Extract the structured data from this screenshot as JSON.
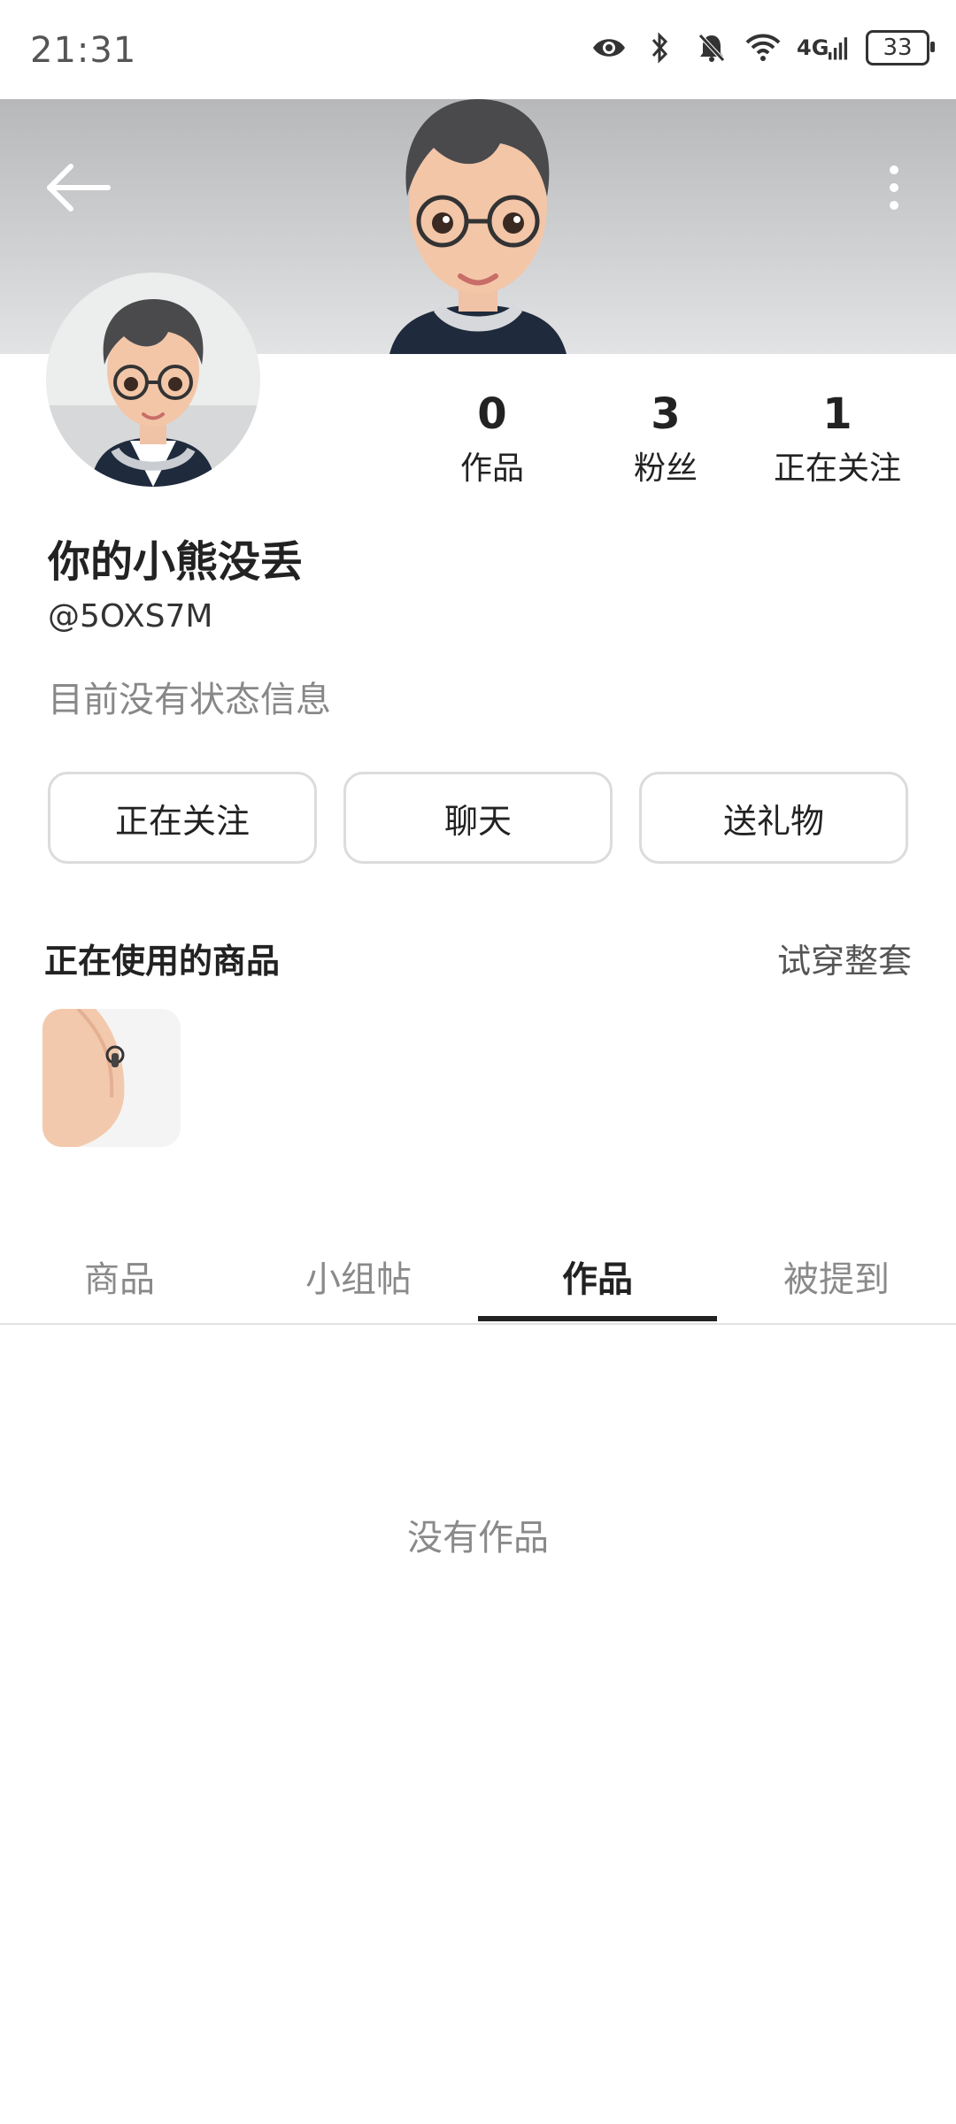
{
  "status_bar": {
    "time": "21:31",
    "network": "4G",
    "battery": "33"
  },
  "profile": {
    "name": "你的小熊没丢",
    "handle": "@5OXS7M",
    "status": "目前没有状态信息"
  },
  "stats": [
    {
      "value": "0",
      "label": "作品"
    },
    {
      "value": "3",
      "label": "粉丝"
    },
    {
      "value": "1",
      "label": "正在关注"
    }
  ],
  "actions": {
    "following": "正在关注",
    "chat": "聊天",
    "gift": "送礼物"
  },
  "items_section": {
    "title": "正在使用的商品",
    "try_outfit": "试穿整套"
  },
  "tabs": [
    {
      "label": "商品"
    },
    {
      "label": "小组帖"
    },
    {
      "label": "作品",
      "active": true
    },
    {
      "label": "被提到"
    }
  ],
  "empty_state": "没有作品"
}
